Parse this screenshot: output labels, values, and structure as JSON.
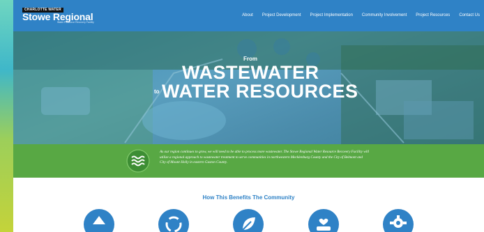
{
  "logo": {
    "badge": "CHARLOTTE WATER",
    "title": "Stowe Regional",
    "subtitle": "Water Resource Recovery Facility"
  },
  "nav": [
    "About",
    "Project Development",
    "Project Implementation",
    "Community Involvement",
    "Project Resources",
    "Contact Us"
  ],
  "hero": {
    "from": "From",
    "line1": "WASTEWATER",
    "to": "to",
    "line2": "WATER RESOURCES"
  },
  "band": {
    "text": "As our region continues to grow, we will need to be able to process more wastewater. The Stowe Regional Water Resource Recovery Facility will utilize a regional approach to wastewater treatment to serve communities in northwestern Mecklenburg County and the City of Belmont and City of Mount Holly in eastern Gaston County."
  },
  "benefits": {
    "title": "How This Benefits The Community"
  },
  "colors": {
    "header": "#2f82c6",
    "band": "#58a844",
    "accent": "#2f82c6"
  }
}
